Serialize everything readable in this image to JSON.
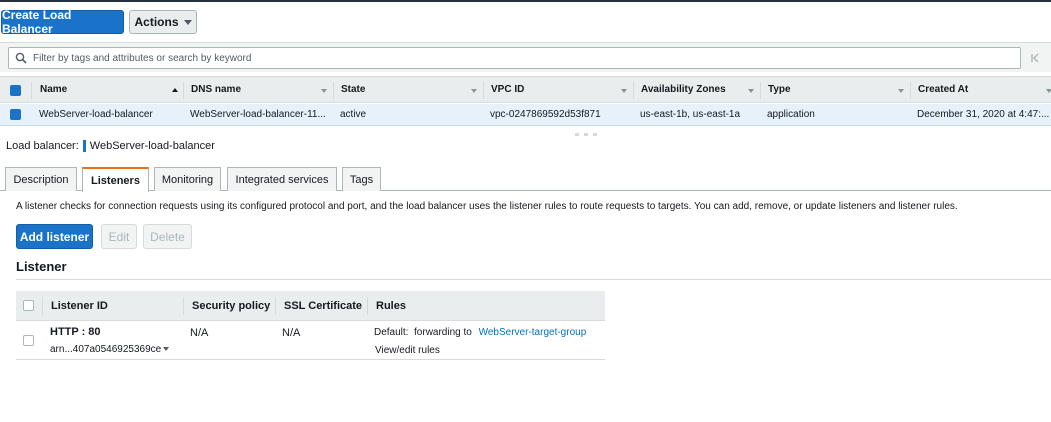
{
  "toolbar": {
    "create_label": "Create Load Balancer",
    "actions_label": "Actions"
  },
  "filter": {
    "placeholder": "Filter by tags and attributes or search by keyword"
  },
  "table": {
    "columns": [
      "Name",
      "DNS name",
      "State",
      "VPC ID",
      "Availability Zones",
      "Type",
      "Created At"
    ],
    "rows": [
      {
        "name": "WebServer-load-balancer",
        "dns": "WebServer-load-balancer-11...",
        "state": "active",
        "vpc": "vpc-0247869592d53f871",
        "azs": "us-east-1b, us-east-1a",
        "type": "application",
        "created": "December 31, 2020 at 4:47:..."
      }
    ]
  },
  "detail": {
    "label": "Load balancer:",
    "name": "WebServer-load-balancer",
    "tabs": [
      "Description",
      "Listeners",
      "Monitoring",
      "Integrated services",
      "Tags"
    ],
    "active_tab": "Listeners",
    "description": "A listener checks for connection requests using its configured protocol and port, and the load balancer uses the listener rules to route requests to targets. You can add, remove, or update listeners and listener rules.",
    "buttons": {
      "add": "Add listener",
      "edit": "Edit",
      "delete": "Delete"
    },
    "section_title": "Listener"
  },
  "listeners": {
    "columns": [
      "Listener ID",
      "Security policy",
      "SSL Certificate",
      "Rules"
    ],
    "rows": [
      {
        "protocol": "HTTP : 80",
        "arn": "arn...407a0546925369ce",
        "security_policy": "N/A",
        "ssl_certificate": "N/A",
        "rule_prefix": "Default:  forwarding to",
        "target_group": "WebServer-target-group",
        "view_edit": "View/edit rules"
      }
    ]
  },
  "colors": {
    "primary": "#1a73c9",
    "selected_row": "#e6f1fa",
    "active_tab_accent": "#ec7211",
    "link": "#0073bb"
  }
}
